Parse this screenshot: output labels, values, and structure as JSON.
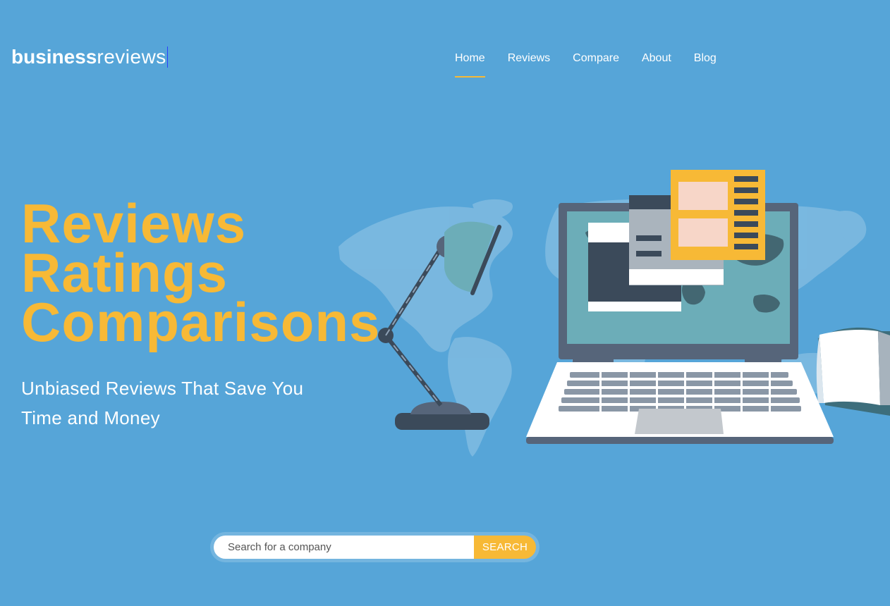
{
  "logo": {
    "bold": "business",
    "light": "reviews"
  },
  "nav": {
    "items": [
      {
        "label": "Home",
        "active": true
      },
      {
        "label": "Reviews",
        "active": false
      },
      {
        "label": "Compare",
        "active": false
      },
      {
        "label": "About",
        "active": false
      },
      {
        "label": "Blog",
        "active": false
      }
    ]
  },
  "hero": {
    "lines": [
      "Reviews",
      "Ratings",
      "Comparisons"
    ],
    "subtitle": "Unbiased Reviews That Save You Time and Money"
  },
  "search": {
    "placeholder": "Search for a company",
    "value": "",
    "button_label": "SEARCH"
  },
  "colors": {
    "background": "#56a5d8",
    "accent": "#f7b936",
    "text": "#ffffff"
  },
  "illustration": {
    "icons": [
      "world-map-icon",
      "desk-lamp-icon",
      "laptop-icon",
      "document-card-icon",
      "open-book-icon"
    ]
  }
}
